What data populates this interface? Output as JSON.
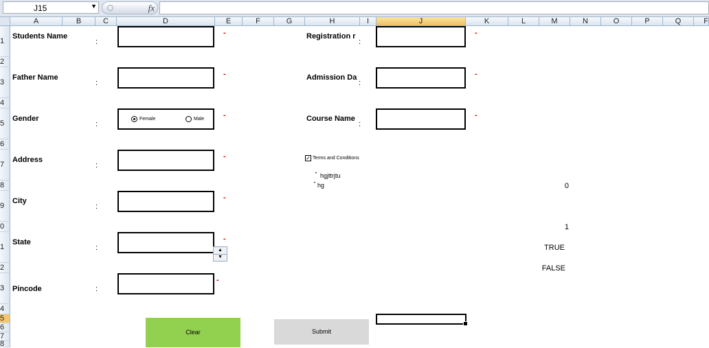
{
  "formula_bar": {
    "name_box": "J15",
    "fx_label": "fx",
    "formula": ""
  },
  "columns": [
    "A",
    "B",
    "C",
    "D",
    "E",
    "F",
    "G",
    "H",
    "I",
    "J",
    "K",
    "L",
    "M",
    "N",
    "O",
    "P",
    "Q",
    "F"
  ],
  "rows": [
    "1",
    "2",
    "3",
    "4",
    "5",
    "6",
    "7",
    "8",
    "9",
    "0",
    "1",
    "2",
    "3",
    "4",
    "5",
    "6",
    "7",
    "8"
  ],
  "form": {
    "left_labels": [
      "Students Name",
      "Father Name",
      "Gender",
      "Address",
      "City",
      "State",
      "Pincode"
    ],
    "right_labels": [
      "Registration r",
      "Admission Da",
      "Course Name"
    ],
    "colon": ":",
    "required_mark": "-",
    "gender_options": [
      "Female",
      "Male"
    ],
    "terms_label": "Terms and Conditions",
    "list_items": [
      "hgjttrjtu",
      "hg"
    ],
    "clear_button": "Clear",
    "submit_button": "Submit"
  },
  "cell_values": {
    "m8": "0",
    "m10": "1",
    "m11": "TRUE",
    "m12": "FALSE"
  }
}
